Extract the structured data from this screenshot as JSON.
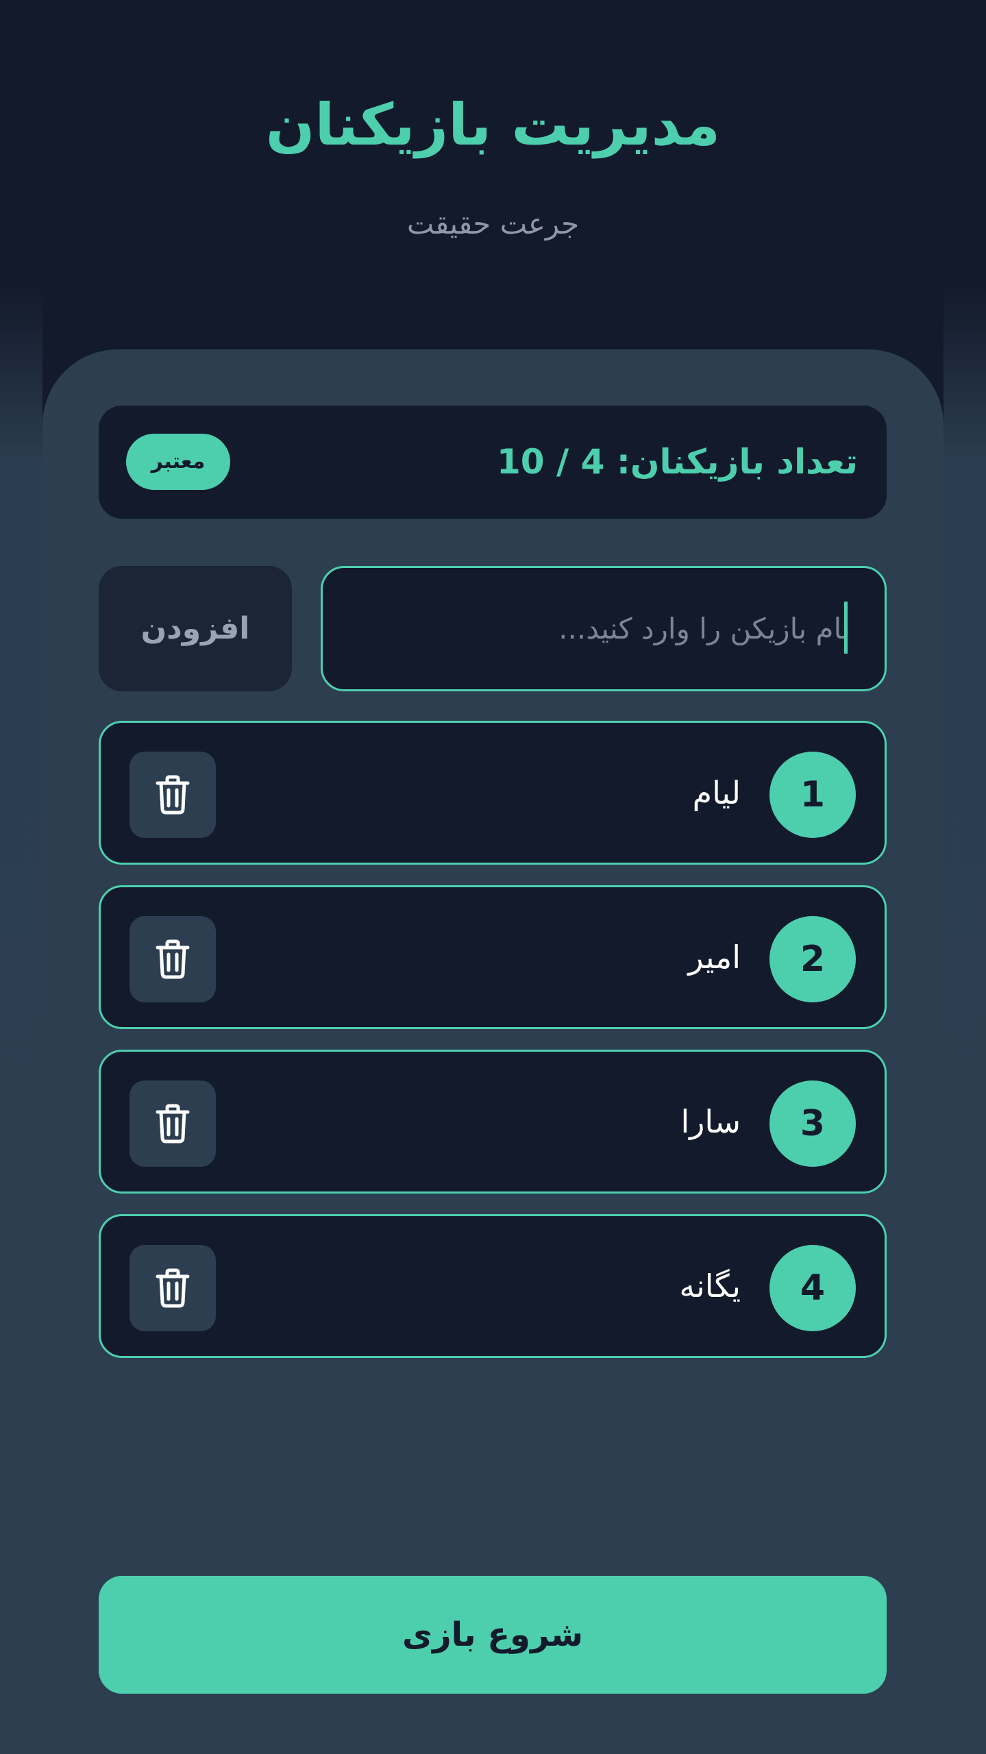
{
  "header": {
    "title": "مدیریت بازیکنان",
    "subtitle": "جرعت حقیقت"
  },
  "count_bar": {
    "label": "تعداد بازیکنان: 4 / 10",
    "status": "معتبر"
  },
  "add_form": {
    "placeholder": "نام بازیکن را وارد کنید...",
    "value": "",
    "add_label": "افزودن"
  },
  "players": [
    {
      "number": "1",
      "name": "لیام"
    },
    {
      "number": "2",
      "name": "امیر"
    },
    {
      "number": "3",
      "name": "سارا"
    },
    {
      "number": "4",
      "name": "یگانه"
    }
  ],
  "icons": {
    "delete": "trash-icon"
  },
  "colors": {
    "accent": "#4dcfae",
    "background": "#131a2b",
    "panel": "#2c3e50"
  },
  "start_label": "شروع بازی"
}
